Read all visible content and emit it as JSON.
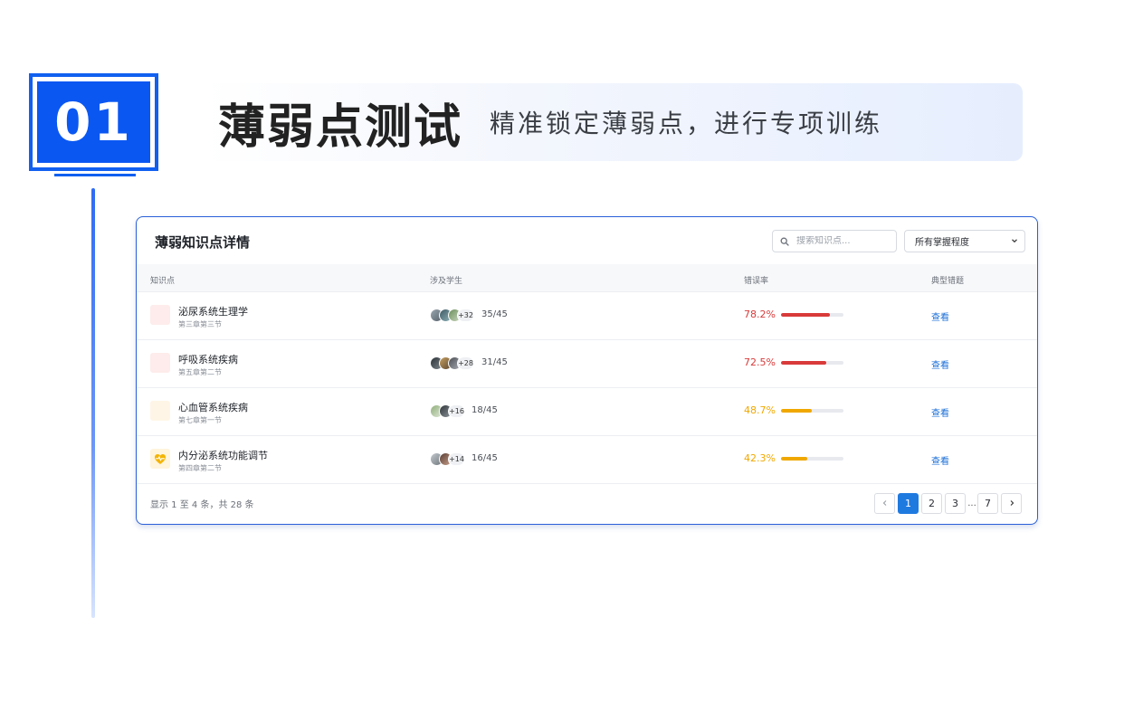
{
  "section": {
    "number": "01",
    "title": "薄弱点测试",
    "subtitle": "精准锁定薄弱点，进行专项训练"
  },
  "card": {
    "title": "薄弱知识点详情",
    "search_placeholder": "搜索知识点...",
    "filter_selected": "所有掌握程度",
    "columns": [
      "知识点",
      "涉及学生",
      "错误率",
      "典型错题"
    ],
    "rows": [
      {
        "name": "泌尿系统生理学",
        "chapter": "第三章第三节",
        "more": "+32",
        "students": "35/45",
        "error_rate": "78.2%",
        "error_value": 0.782,
        "rate_color": "#d93a3a",
        "icon_bg": "#fdeceb",
        "icon": "blank",
        "action": "查看"
      },
      {
        "name": "呼吸系统疾病",
        "chapter": "第五章第二节",
        "more": "+28",
        "students": "31/45",
        "error_rate": "72.5%",
        "error_value": 0.725,
        "rate_color": "#d93a3a",
        "icon_bg": "#fdeceb",
        "icon": "blank",
        "action": "查看"
      },
      {
        "name": "心血管系统疾病",
        "chapter": "第七章第一节",
        "more": "+16",
        "students": "18/45",
        "error_rate": "48.7%",
        "error_value": 0.487,
        "rate_color": "#f0a800",
        "icon_bg": "#fff5e6",
        "icon": "blank",
        "action": "查看"
      },
      {
        "name": "内分泌系统功能调节",
        "chapter": "第四章第二节",
        "more": "+14",
        "students": "16/45",
        "error_rate": "42.3%",
        "error_value": 0.423,
        "rate_color": "#f0a800",
        "icon_bg": "#fff4dc",
        "icon": "heart-pulse-icon",
        "action": "查看"
      }
    ],
    "footer": "显示 1 至 4 条，共 28 条",
    "pagination": {
      "pages": [
        "1",
        "2",
        "3"
      ],
      "ellipsis": "...",
      "last": "7",
      "current": "1"
    }
  }
}
